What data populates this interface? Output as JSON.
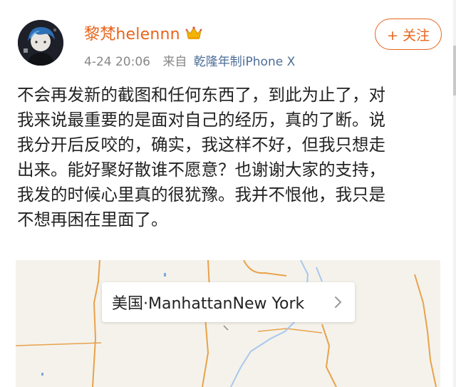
{
  "user": {
    "name": "黎梵helennn",
    "badge_icon": "crown-icon",
    "avatar_icon": "avatar-icon"
  },
  "meta": {
    "time": "4-24 20:06",
    "from_label": "来自",
    "device": "乾隆年制iPhone X"
  },
  "follow_button": {
    "label": "+ 关注"
  },
  "post": {
    "lines": [
      "不会再发新的截图和任何东西了，到此为止了，对",
      "我来说最重要的是面对自己的经历，真的了断。说",
      "我分开后反咬的，确实，我这样不好，但我只想走",
      "出来。能好聚好散谁不愿意？也谢谢大家的支持，",
      "我发的时候心里真的很犹豫。我并不恨他，我只是",
      "不想再困在里面了。"
    ]
  },
  "location": {
    "label": "美国·ManhattanNew York",
    "chevron_icon": "chevron-right-icon"
  },
  "colors": {
    "accent": "#e8641c",
    "link": "#4c6d98",
    "meta_gray": "#888888",
    "text": "#222222",
    "map_bg": "#f5f2ec",
    "map_road": "#e8a24a",
    "map_water": "#a8c8ec"
  }
}
